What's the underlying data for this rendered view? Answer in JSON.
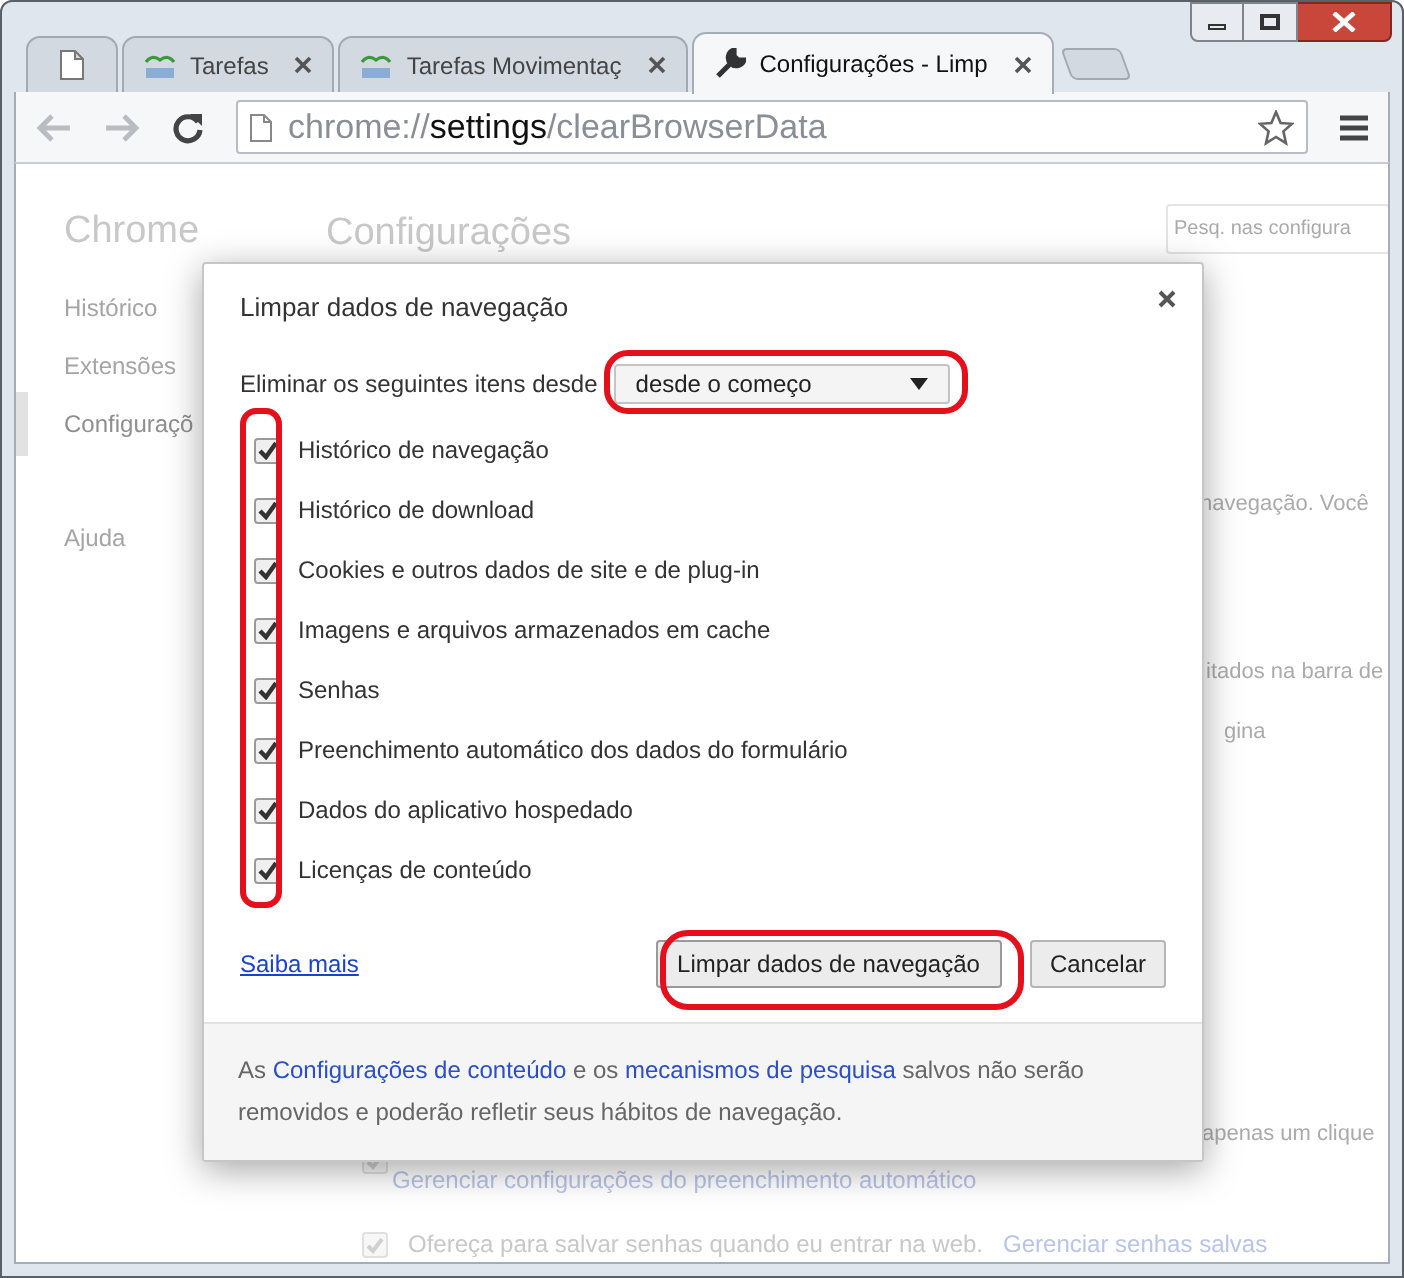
{
  "tabs": [
    {
      "kind": "page",
      "selected": false
    },
    {
      "kind": "site",
      "title": "Tarefas",
      "selected": false
    },
    {
      "kind": "site",
      "title": "Tarefas Movimentaç",
      "selected": false
    },
    {
      "kind": "wrench",
      "title": "Configurações - Limp",
      "selected": true
    }
  ],
  "address_bar": {
    "scheme": "chrome://",
    "host": "settings",
    "path": "/clearBrowserData"
  },
  "settings_page": {
    "brand": "Chrome",
    "title": "Configurações",
    "search": {
      "placeholder": "Pesq. nas configura"
    },
    "sidebar": [
      {
        "label": "Histórico",
        "selected": false
      },
      {
        "label": "Extensões",
        "selected": false
      },
      {
        "label": "Configuraçõ",
        "selected": true
      },
      {
        "label": "Ajuda",
        "selected": false
      }
    ],
    "fragments": [
      "navegação. Você",
      "itados na barra de",
      "gina",
      "apenas um clique"
    ],
    "options": [
      {
        "checked": true,
        "link": "Gerenciar configurações do preenchimento automático"
      },
      {
        "checked": true,
        "label": "Ofereça para salvar senhas quando eu entrar na web.",
        "link": "Gerenciar senhas salvas"
      }
    ]
  },
  "dialog": {
    "title": "Limpar dados de navegação",
    "period_label": "Eliminar os seguintes itens desde",
    "period": "desde o começo",
    "items": [
      {
        "label": "Histórico de navegação",
        "checked": true
      },
      {
        "label": "Histórico de download",
        "checked": true
      },
      {
        "label": "Cookies e outros dados de site e de plug-in",
        "checked": true
      },
      {
        "label": "Imagens e arquivos armazenados em cache",
        "checked": true
      },
      {
        "label": "Senhas",
        "checked": true
      },
      {
        "label": "Preenchimento automático dos dados do formulário",
        "checked": true
      },
      {
        "label": "Dados do aplicativo hospedado",
        "checked": true
      },
      {
        "label": "Licenças de conteúdo",
        "checked": true
      }
    ],
    "learn_more": "Saiba mais",
    "buttons": [
      {
        "label": "Limpar dados de navegação",
        "kind": "primary"
      },
      {
        "label": "Cancelar",
        "kind": "secondary"
      }
    ],
    "footer": [
      {
        "kind": "text",
        "text": "As "
      },
      {
        "kind": "link",
        "text": "Configurações de conteúdo"
      },
      {
        "kind": "text",
        "text": " e os "
      },
      {
        "kind": "link",
        "text": "mecanismos de pesquisa"
      },
      {
        "kind": "text",
        "text": " salvos não serão removidos e poderão refletir seus hábitos de navegação."
      }
    ]
  }
}
